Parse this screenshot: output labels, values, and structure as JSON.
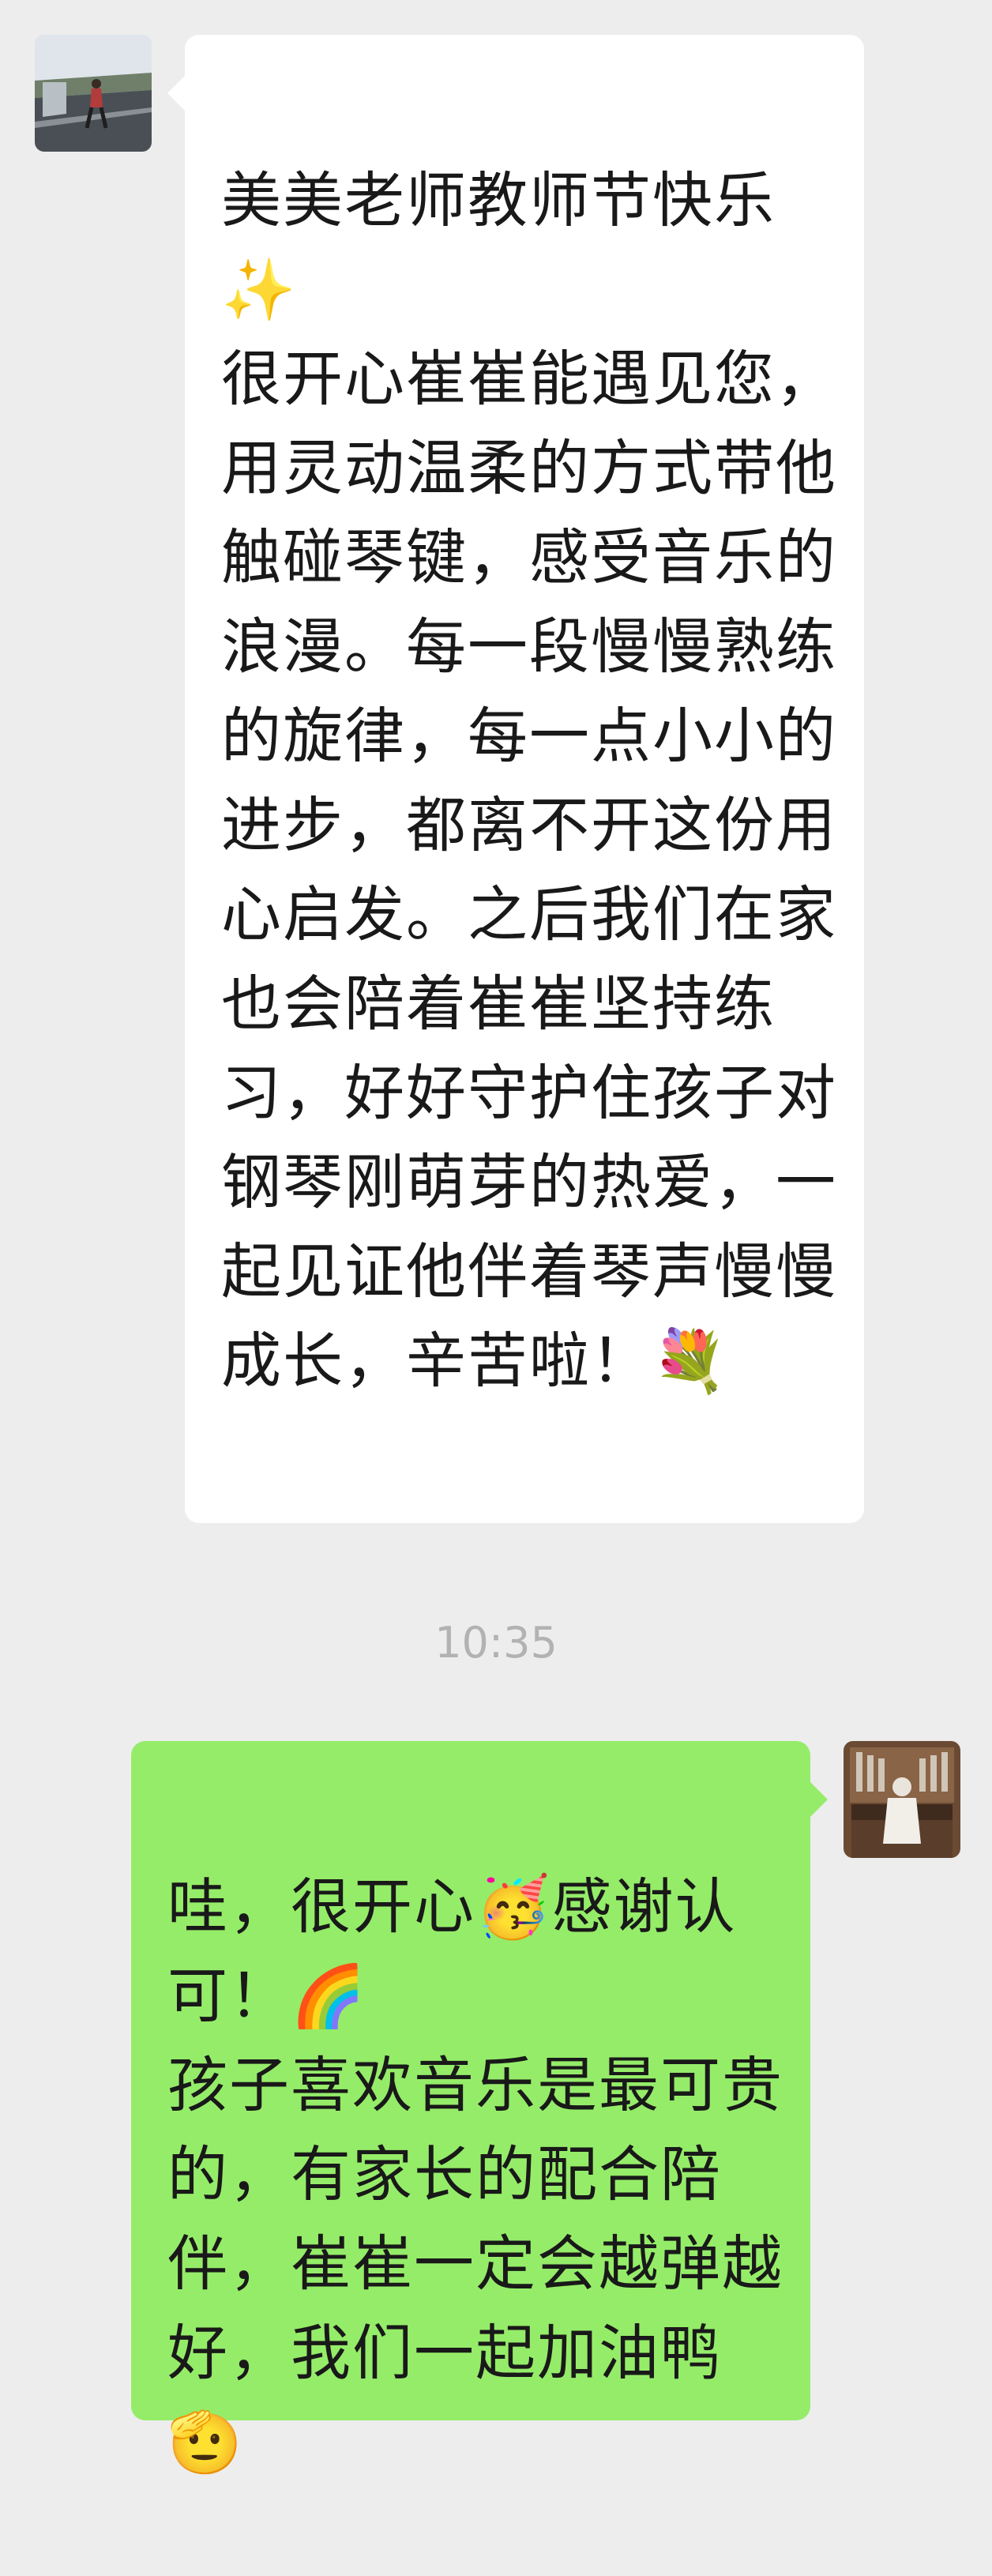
{
  "chat": {
    "timestamp": "10:35",
    "messages": [
      {
        "sender": "received",
        "text": "美美老师教师节快乐\n✨\n很开心崔崔能遇见您，用灵动温柔的方式带他触碰琴键，感受音乐的浪漫。每一段慢慢熟练的旋律，每一点小小的进步，都离不开这份用心启发。之后我们在家也会陪着崔崔坚持练习，好好守护住孩子对钢琴刚萌芽的热爱，一起见证他伴着琴声慢慢成长，辛苦啦！💐"
      },
      {
        "sender": "sent",
        "text": "哇，很开心🥳感谢认可！🌈\n孩子喜欢音乐是最可贵的，有家长的配合陪伴，崔崔一定会越弹越好，我们一起加油鸭🫡"
      }
    ]
  },
  "colors": {
    "background": "#ededed",
    "received_bubble": "#ffffff",
    "sent_bubble": "#95ec69",
    "timestamp_text": "#b2b2b2"
  },
  "icons": {
    "left_avatar": "avatar-road-runner",
    "right_avatar": "avatar-organ-player"
  }
}
